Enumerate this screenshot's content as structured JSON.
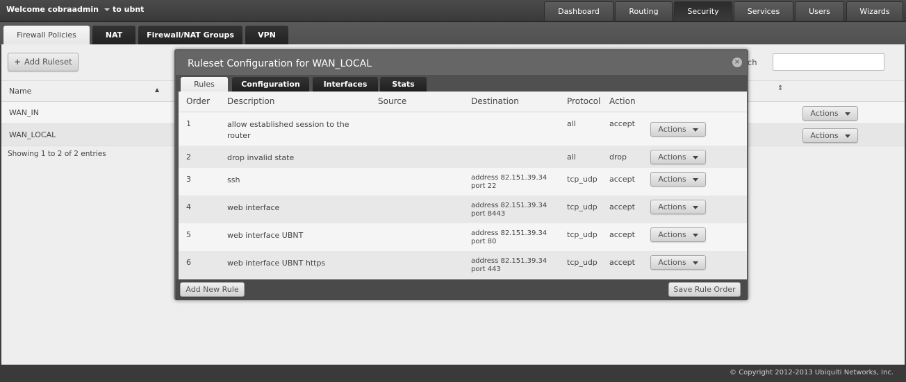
{
  "header": {
    "welcome": "Welcome cobraadmin",
    "host": "to ubnt",
    "nav": [
      "Dashboard",
      "Routing",
      "Security",
      "Services",
      "Users",
      "Wizards"
    ],
    "active_nav": "Security"
  },
  "subtabs": [
    "Firewall Policies",
    "NAT",
    "Firewall/NAT Groups",
    "VPN"
  ],
  "page": {
    "add_ruleset": "Add Ruleset",
    "search_label": "Search",
    "search_value": "",
    "column_name": "Name",
    "rows": [
      {
        "name": "WAN_IN",
        "actions": "Actions"
      },
      {
        "name": "WAN_LOCAL",
        "actions": "Actions"
      }
    ],
    "showing": "Showing 1 to 2 of 2 entries"
  },
  "modal": {
    "title": "Ruleset Configuration for WAN_LOCAL",
    "tabs": [
      "Rules",
      "Configuration",
      "Interfaces",
      "Stats"
    ],
    "columns": [
      "Order",
      "Description",
      "Source",
      "Destination",
      "Protocol",
      "Action"
    ],
    "rules": [
      {
        "order": "1",
        "description": "allow established session to the router",
        "source": "",
        "dest1": "",
        "dest2": "",
        "protocol": "all",
        "action": "accept",
        "btn": "Actions"
      },
      {
        "order": "2",
        "description": "drop invalid state",
        "source": "",
        "dest1": "",
        "dest2": "",
        "protocol": "all",
        "action": "drop",
        "btn": "Actions"
      },
      {
        "order": "3",
        "description": "ssh",
        "source": "",
        "dest1": "address 82.151.39.34",
        "dest2": "port 22",
        "protocol": "tcp_udp",
        "action": "accept",
        "btn": "Actions"
      },
      {
        "order": "4",
        "description": "web interface",
        "source": "",
        "dest1": "address 82.151.39.34",
        "dest2": "port 8443",
        "protocol": "tcp_udp",
        "action": "accept",
        "btn": "Actions"
      },
      {
        "order": "5",
        "description": "web interface UBNT",
        "source": "",
        "dest1": "address 82.151.39.34",
        "dest2": "port 80",
        "protocol": "tcp_udp",
        "action": "accept",
        "btn": "Actions"
      },
      {
        "order": "6",
        "description": "web interface UBNT https",
        "source": "",
        "dest1": "address 82.151.39.34",
        "dest2": "port 443",
        "protocol": "tcp_udp",
        "action": "accept",
        "btn": "Actions"
      }
    ],
    "add_rule": "Add New Rule",
    "save_order": "Save Rule Order"
  },
  "footer": {
    "copyright": "© Copyright 2012-2013 Ubiquiti Networks, Inc."
  }
}
